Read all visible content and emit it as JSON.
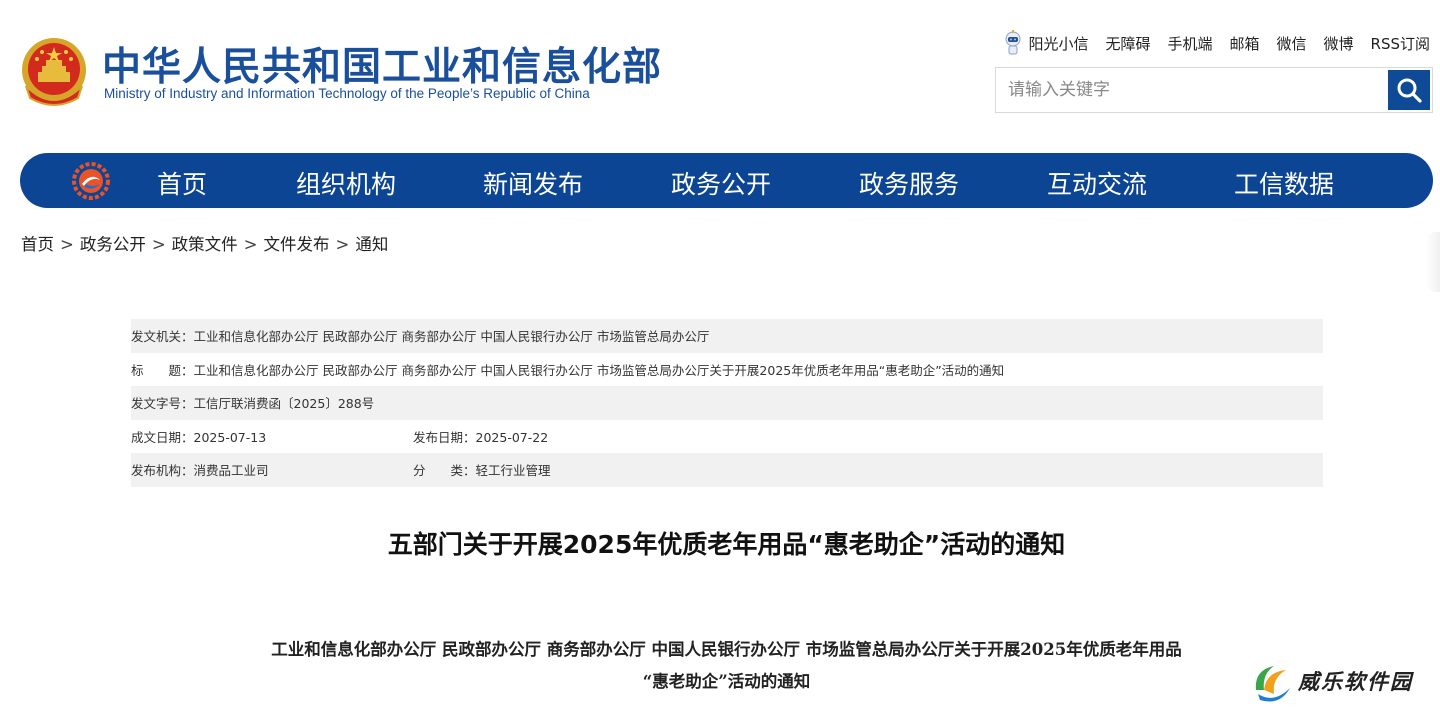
{
  "header": {
    "title_cn": "中华人民共和国工业和信息化部",
    "title_en": "Ministry of Industry and Information Technology of the People’s Republic of China",
    "toplinks": [
      "阳光小信",
      "无障碍",
      "手机端",
      "邮箱",
      "微信",
      "微博",
      "RSS订阅"
    ],
    "search_placeholder": "请输入关键字"
  },
  "nav": {
    "items": [
      "首页",
      "组织机构",
      "新闻发布",
      "政务公开",
      "政务服务",
      "互动交流",
      "工信数据"
    ]
  },
  "breadcrumb": [
    "首页",
    "政务公开",
    "政策文件",
    "文件发布",
    "通知"
  ],
  "breadcrumb_sep": ">",
  "info": {
    "issuer_label": "发文机关：",
    "issuer": "工业和信息化部办公厅 民政部办公厅 商务部办公厅 中国人民银行办公厅 市场监管总局办公厅",
    "title_label": "标　　题：",
    "title": "工业和信息化部办公厅 民政部办公厅 商务部办公厅 中国人民银行办公厅 市场监管总局办公厅关于开展2025年优质老年用品“惠老助企”活动的通知",
    "docno_label": "发文字号：",
    "docno": "工信厅联消费函〔2025〕288号",
    "written_label": "成文日期：",
    "written": "2025-07-13",
    "published_label": "发布日期：",
    "published": "2025-07-22",
    "org_label": "发布机构：",
    "org": "消费品工业司",
    "category_label": "分　　类：",
    "category": "轻工行业管理"
  },
  "article": {
    "title": "五部门关于开展2025年优质老年用品“惠老助企”活动的通知",
    "heading_line1": "工业和信息化部办公厅  民政部办公厅  商务部办公厅  中国人民银行办公厅  市场监管总局办公厅关于开展2025年优质老年用品",
    "heading_line2": "“惠老助企”活动的通知"
  },
  "watermark": {
    "text": "威乐软件园"
  },
  "colors": {
    "brand_blue": "#0d4595",
    "row_gray": "#f1f1f1"
  }
}
